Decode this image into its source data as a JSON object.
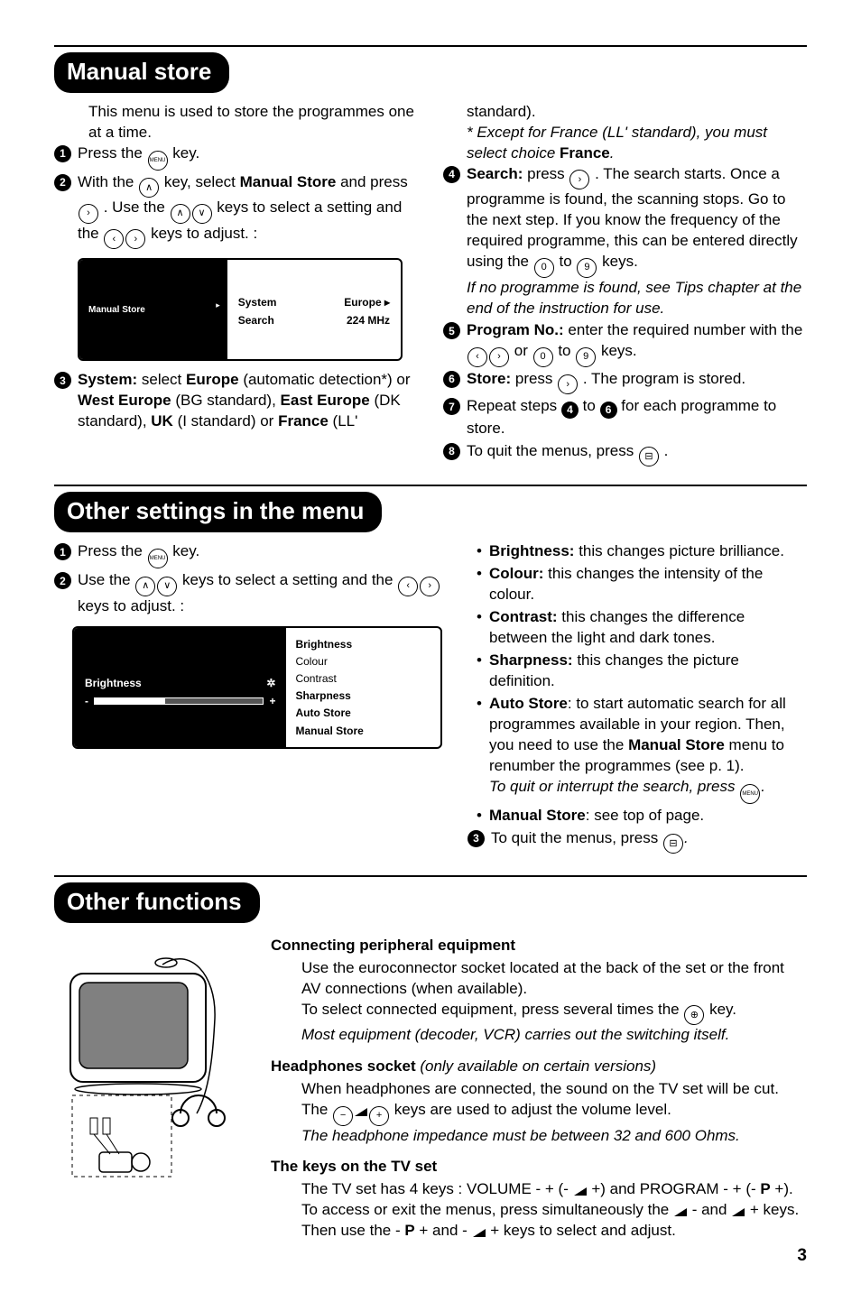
{
  "manual_store": {
    "title": "Manual store",
    "intro": "This menu is used to store the programmes one at a time.",
    "step1": "Press the ",
    "step1b": " key.",
    "step2a": "With the ",
    "step2b": " key, select ",
    "step2c": "Manual Store",
    "step2d": " and press ",
    "step2e": ". Use the ",
    "step2f": " keys to select a setting and the ",
    "step2g": " keys to adjust. :",
    "osd_left": "Manual Store",
    "osd_r1a": "System",
    "osd_r1b": "Europe ▸",
    "osd_r2a": "Search",
    "osd_r2b": "224 MHz",
    "step3a": "System:",
    "step3b": " select ",
    "step3c": "Europe",
    "step3d": " (automatic detection*) or ",
    "step3e": "West Europe",
    "step3f": " (BG standard), ",
    "step3g": "East Europe",
    "step3h": " (DK standard), ",
    "step3i": "UK",
    "step3j": " (I standard) or ",
    "step3k": "France",
    "step3l": " (LL' ",
    "rc_top": "standard).",
    "rc_note": "* Except for France (LL' standard), you must select choice ",
    "rc_note_b": "France",
    "rc_note_c": ".",
    "s4a": "Search:",
    "s4b": " press ",
    "s4c": ". The search starts. Once a programme is found, the scanning stops. Go to the next step. If you know the frequency of the required programme, this can be entered directly using the ",
    "s4d": " to ",
    "s4e": " keys.",
    "s4f": "If no programme is found, see Tips chapter at the end of the instruction for use.",
    "s5a": "Program No.:",
    "s5b": " enter the required number with the ",
    "s5c": " or ",
    "s5d": " to ",
    "s5e": " keys.",
    "s6a": "Store:",
    "s6b": " press ",
    "s6c": ". The program is stored.",
    "s7a": "Repeat steps ",
    "s7b": " to ",
    "s7c": " for each programme to store.",
    "s8a": "To quit the menus, press ",
    "s8b": "."
  },
  "other_settings": {
    "title": "Other settings in the menu",
    "s1": "Press the ",
    "s1b": " key.",
    "s2a": "Use the ",
    "s2b": " keys to select a setting and the ",
    "s2c": " keys to adjust. :",
    "osd_left_label": "Brightness",
    "osd_star": "✲",
    "osd_plus": "+",
    "osd_minus": "-",
    "osd_r": [
      "Brightness",
      "Colour",
      "Contrast",
      "Sharpness",
      "Auto Store",
      "Manual Store"
    ],
    "b_bright": "Brightness:",
    "b_bright_t": " this changes picture brilliance.",
    "b_colour": "Colour:",
    "b_colour_t": " this changes the intensity of the colour.",
    "b_contrast": "Contrast:",
    "b_contrast_t": " this changes the difference between the light and dark tones.",
    "b_sharp": "Sharpness:",
    "b_sharp_t": " this changes the picture definition.",
    "b_auto": "Auto Store",
    "b_auto_t1": ": to start automatic search for all programmes available in your region. Then, you need to use the ",
    "b_auto_t2": "Manual Store",
    "b_auto_t3": " menu to renumber the programmes (see p. 1).",
    "b_auto_note": "To quit or interrupt the search, press ",
    "b_auto_note2": ".",
    "b_manual": "Manual Store",
    "b_manual_t": ": see top of page.",
    "s3a": "To quit the menus, press ",
    "s3b": "."
  },
  "other_functions": {
    "title": "Other functions",
    "h1": "Connecting peripheral equipment",
    "h1_t1": "Use the euroconnector socket located at the back of the set or the front AV connections (when available).",
    "h1_t2a": "To select connected equipment, press several times the ",
    "h1_t2b": " key.",
    "h1_t3": "Most equipment (decoder, VCR) carries out the switching itself.",
    "h2a": "Headphones socket",
    "h2b": " (only available on certain versions)",
    "h2_t1": "When headphones are connected, the sound on the TV set will be cut.",
    "h2_t2a": "The ",
    "h2_t2b": " keys are used to adjust the volume level.",
    "h2_t3": "The headphone impedance must be between 32 and 600 Ohms.",
    "h3": "The keys on the TV set",
    "h3_t1a": "The TV set has 4 keys : VOLUME - + (- ",
    "h3_t1b": " +) and PROGRAM - + (- ",
    "h3_t1c": "P",
    "h3_t1d": " +).",
    "h3_t2a": "To access or exit the menus, press simultaneously the ",
    "h3_t2b": " - and ",
    "h3_t2c": " + keys. Then use the - ",
    "h3_t2d": "P",
    "h3_t2e": " + and - ",
    "h3_t2f": " + keys to select and adjust."
  },
  "keys": {
    "menu": "MENU",
    "up": "∧",
    "down": "∨",
    "left": "‹",
    "right": "›",
    "zero": "0",
    "nine": "9",
    "list": "⊟",
    "av": "⊕",
    "minus": "−",
    "plus": "+"
  },
  "page_number": "3"
}
